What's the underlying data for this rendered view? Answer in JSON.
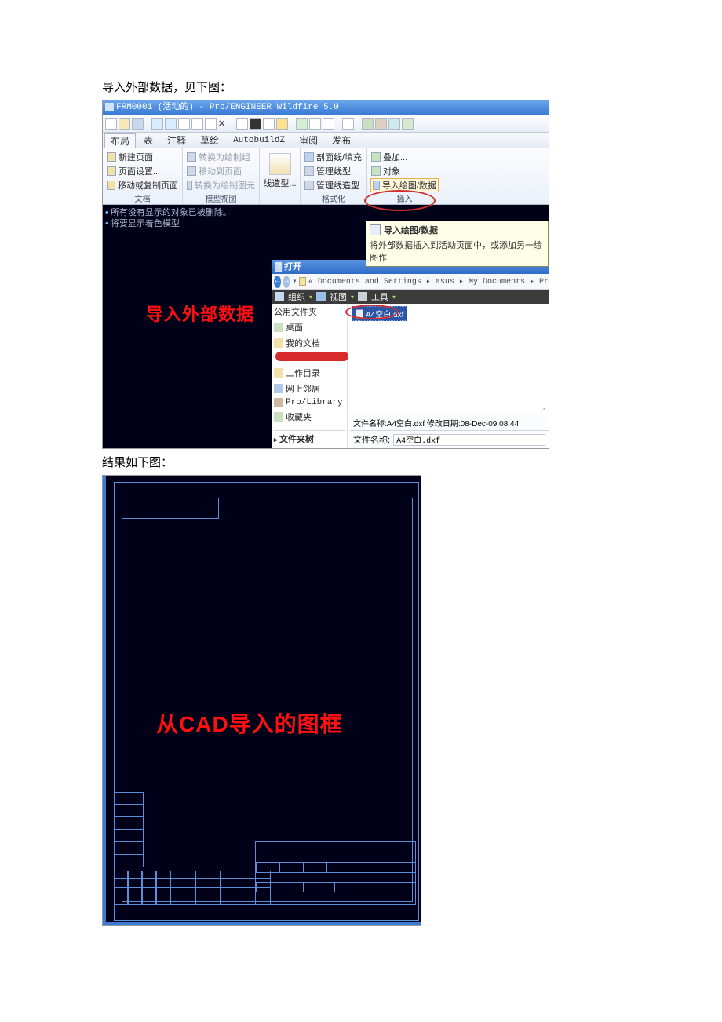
{
  "doc": {
    "caption1": "导入外部数据，见下图：",
    "caption2": "结果如下图："
  },
  "app": {
    "title": "FRM0001 (活动的) - Pro/ENGINEER Wildfire 5.0",
    "menus": {
      "layout": "布局",
      "table": "表",
      "annotate": "注释",
      "sketch": "草绘",
      "autobuild": "AutobuildZ",
      "review": "审阅",
      "publish": "发布"
    },
    "ribbon": {
      "group_doc_label": "文档",
      "new_page": "新建页面",
      "page_setup": "页面设置...",
      "move_copy_page": "移动或复制页面",
      "to_draw_group": "转换为绘制组",
      "move_to_page": "移动到页面",
      "to_draw_elem": "转换为绘制图元",
      "model_view_label": "模型视图",
      "lntype": "线造型...",
      "format_label": "格式化",
      "section_fill": "剖面线/填充",
      "mng_lntype": "管理线型",
      "mng_lnstyle": "管理线造型",
      "overlay": "叠加...",
      "object": "对象",
      "import_drawing": "导入绘图/数据",
      "insert_label": "插入"
    },
    "messages": {
      "m1": "所有没有显示的对象已被删除。",
      "m2": "将要显示着色模型"
    },
    "canvas_label": "导入外部数据",
    "tooltip": {
      "title": "导入绘图/数据",
      "desc": "将外部数据插入到活动页面中，或添加另一绘图作"
    }
  },
  "open_dialog": {
    "title": "打开",
    "breadcrumb": "« Documents and Settings ▸ asus ▸ My Documents ▸ Pr",
    "toolbar": {
      "org": "组织",
      "view": "视图",
      "tools": "工具"
    },
    "side": {
      "common": "公用文件夹",
      "desktop": "桌面",
      "mydocs": "我的文档",
      "workdir": "工作目录",
      "network": "网上邻居",
      "prolib": "Pro/Library",
      "fav": "收藏夹",
      "tree": "文件夹树"
    },
    "file_item": "A4空白.dxf",
    "info_line": "文件名称:A4空白.dxf 修改日期:08-Dec-09 08:44:",
    "fn_label": "文件名称:",
    "fn_value": "A4空白.dxf"
  },
  "result": {
    "label": "从CAD导入的图框"
  }
}
